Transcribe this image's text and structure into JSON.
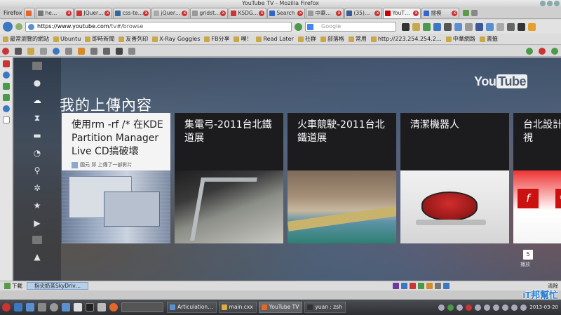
{
  "window": {
    "title": "YouTube TV - Mozilla Firefox"
  },
  "firefox_menu": "Firefox",
  "tabs": [
    {
      "label": "",
      "icon_color": "#e3672a"
    },
    {
      "label": "he…",
      "icon_color": "#777777"
    },
    {
      "label": "JQuer…",
      "icon_color": "#cc3333"
    },
    {
      "label": "css-te…",
      "icon_color": "#336699"
    },
    {
      "label": "jQuer…",
      "icon_color": "#aaaaaa"
    },
    {
      "label": "gridst…",
      "icon_color": "#999999"
    },
    {
      "label": "KSDG…",
      "icon_color": "#cc3333"
    },
    {
      "label": "Search",
      "icon_color": "#3366cc"
    },
    {
      "label": "中華…",
      "icon_color": "#999999"
    },
    {
      "label": "(35)…",
      "icon_color": "#3b5998"
    },
    {
      "label": "YouT…",
      "icon_color": "#cc0000",
      "active": true
    },
    {
      "label": "搜模",
      "icon_color": "#3366cc"
    }
  ],
  "nav": {
    "url_host": "https://www.youtube.com",
    "url_path": "tv#/browse",
    "search_placeholder": "Google"
  },
  "bookmarks": [
    "最常瀏覽的網站",
    "Ubuntu",
    "即時新聞",
    "友善列印",
    "X-Ray Goggles",
    "FB分享",
    "噗！",
    "Read Later",
    "社群",
    "部落格",
    "常用",
    "http://223.254.254.2…",
    "中華網路",
    "書籤"
  ],
  "youtube": {
    "logo_you": "You",
    "logo_tube": "Tube",
    "section_title": "我的上傳內容",
    "rail_icons": [
      "thumbnail-icon",
      "bulb-icon",
      "upload-icon",
      "hourglass-icon",
      "chat-icon",
      "clock-icon",
      "search-icon",
      "gear-icon",
      "star-icon",
      "youtube-icon",
      "thumbnail-icon",
      "android-icon"
    ],
    "cards": [
      {
        "title": "使用rm -rf /* 在KDE Partition Manager Live CD搞破壞",
        "uploader": "國元 邱 上傳了一部影片",
        "selected": true
      },
      {
        "title": "集電弓-2011台北鐵道展"
      },
      {
        "title": "火車競駛-2011台北鐵道展"
      },
      {
        "title": "清潔機器人"
      },
      {
        "title": "台北設計視"
      }
    ],
    "page_number": "5",
    "page_label": "播放"
  },
  "statusbar": {
    "downloads_label": "下載",
    "download_item": "指尖奶茶SkyDriv…",
    "clear_label": "清除"
  },
  "taskbar": {
    "tasks": [
      {
        "label": "Articulation…",
        "icon_color": "#5a8fd0"
      },
      {
        "label": "main.cxx",
        "icon_color": "#ddaa44"
      },
      {
        "label": "YouTube TV",
        "icon_color": "#e3672a",
        "active": true
      },
      {
        "label": "yuan : zsh",
        "icon_color": "#333333"
      }
    ],
    "clock": "2013-03-20"
  },
  "watermark": "iT邦幫忙"
}
